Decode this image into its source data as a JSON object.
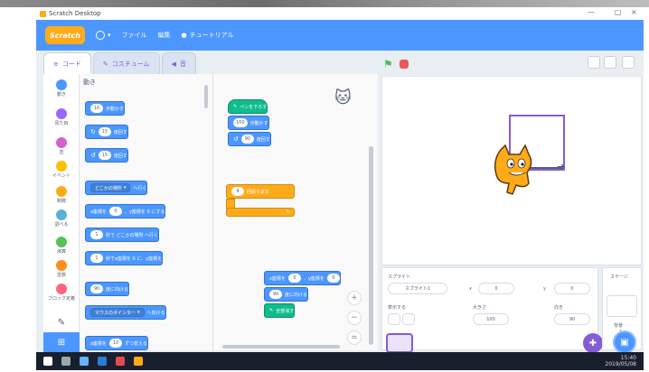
{
  "window": {
    "title": "Scratch Desktop",
    "minimize": "—",
    "close": "×"
  },
  "menubar": {
    "logo": "Scratch",
    "items": [
      {
        "label": "ファイル"
      },
      {
        "label": "編集"
      },
      {
        "label": "チュートリアル"
      }
    ]
  },
  "tabs": [
    {
      "label": "コード"
    },
    {
      "label": "コスチューム"
    },
    {
      "label": "音"
    }
  ],
  "categories": [
    {
      "label": "動き",
      "color": "#4c97ff"
    },
    {
      "label": "見た目",
      "color": "#9966ff"
    },
    {
      "label": "音",
      "color": "#cf63cf"
    },
    {
      "label": "イベント",
      "color": "#ffbf00"
    },
    {
      "label": "制御",
      "color": "#ffab19"
    },
    {
      "label": "調べる",
      "color": "#5cb1d6"
    },
    {
      "label": "演算",
      "color": "#59c059"
    },
    {
      "label": "変数",
      "color": "#ff8c1a"
    },
    {
      "label": "ブロック定義",
      "color": "#ff6680"
    }
  ],
  "flyout": {
    "heading": "動き",
    "blocks": [
      {
        "pre": "",
        "value": "10",
        "post": "歩動かす"
      },
      {
        "pre": "↻",
        "value": "15",
        "post": "度回す"
      },
      {
        "pre": "↺",
        "value": "15",
        "post": "度回す"
      },
      {
        "pre": "",
        "value": "どこかの場所",
        "post": "へ行く"
      },
      {
        "pre": "x座標を",
        "value": "0",
        "post": "、y座標を 0 にする"
      },
      {
        "pre": "",
        "value": "1",
        "post": "秒で どこかの場所 へ行く"
      },
      {
        "pre": "",
        "value": "1",
        "post": "秒でx座標を 0 に、y座標を"
      },
      {
        "pre": "",
        "value": "90",
        "post": "度に向ける"
      },
      {
        "pre": "",
        "value": "マウスのポインター",
        "post": "へ向ける"
      },
      {
        "pre": "x座標を",
        "value": "10",
        "post": "ずつ変える"
      }
    ]
  },
  "script": {
    "group1": [
      "ペンを下ろす",
      "100",
      "歩動かす",
      "90",
      "度回す"
    ],
    "repeat": {
      "value": "4",
      "label": "回繰り返す"
    },
    "group2": {
      "x": "0",
      "y": "0",
      "dir": "90",
      "label1": "x座標を",
      "label2": "、y座標を",
      "label3": "度に向ける",
      "pen": "全部消す"
    }
  },
  "zoom": {
    "in": "+",
    "out": "−",
    "reset": "="
  },
  "sprite_info": {
    "sprite_label": "スプライト",
    "sprite_name": "スプライト1",
    "x_label": "x",
    "x_value": "0",
    "y_label": "y",
    "y_value": "0",
    "show_label": "表示する",
    "size_label": "大きさ",
    "size_value": "100",
    "direction_label": "向き",
    "direction_value": "90"
  },
  "stage_panel": {
    "label": "ステージ",
    "backdrops_label": "背景",
    "backdrops_count": "1"
  },
  "taskbar": {
    "time": "15:40",
    "date": "2019/05/08"
  }
}
